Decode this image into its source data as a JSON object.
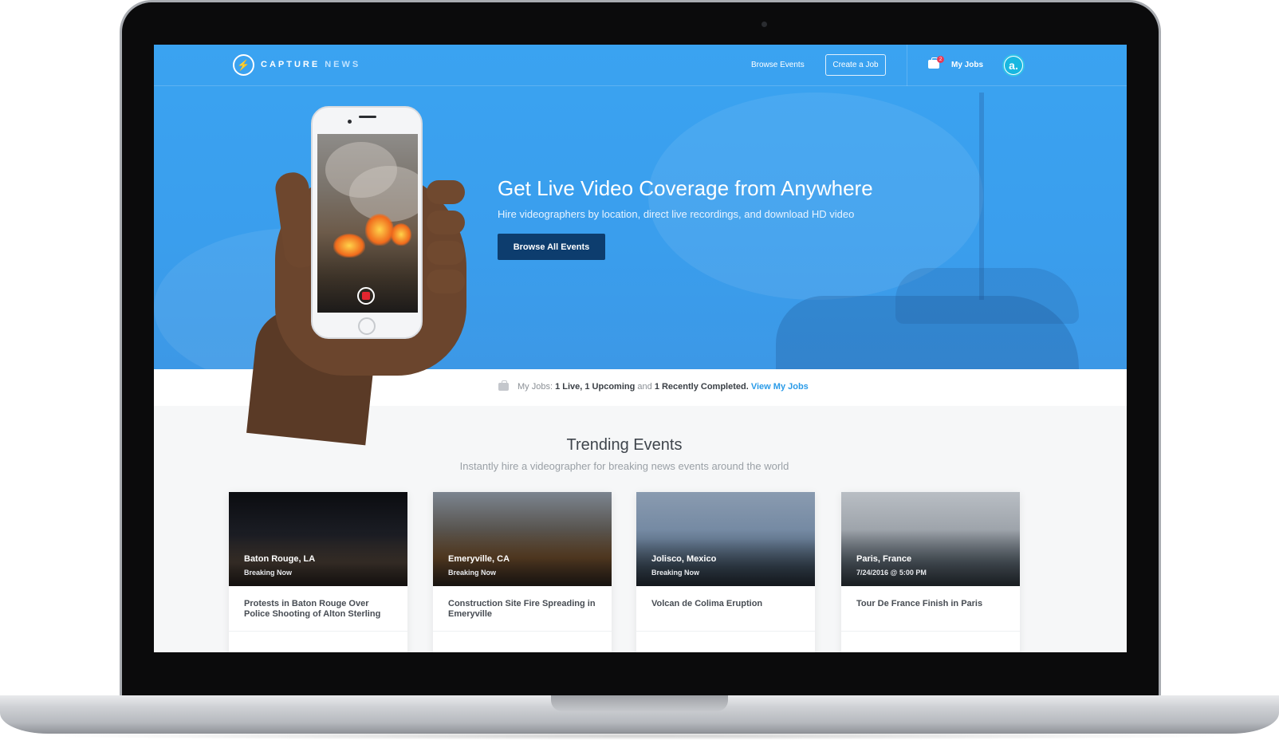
{
  "nav": {
    "logo_left": "CAPTURE",
    "logo_right": "NEWS",
    "browse_events": "Browse Events",
    "create_job": "Create a Job",
    "my_jobs": "My Jobs",
    "jobs_badge": "2",
    "avatar_letter": "a."
  },
  "hero": {
    "title": "Get Live Video Coverage from Anywhere",
    "subtitle": "Hire videographers by location, direct live recordings, and download HD video",
    "button": "Browse All Events"
  },
  "jobs_bar": {
    "label": "My Jobs:",
    "summary_a": "1 Live, 1 Upcoming",
    "and": "and",
    "summary_b": "1 Recently Completed.",
    "link": "View My Jobs"
  },
  "trending": {
    "title": "Trending Events",
    "subtitle": "Instantly hire a videographer for breaking news events around the world",
    "cards": [
      {
        "location": "Baton Rouge, LA",
        "status": "Breaking Now",
        "title": "Protests in Baton Rouge Over Police Shooting of Alton Sterling"
      },
      {
        "location": "Emeryville, CA",
        "status": "Breaking Now",
        "title": "Construction Site Fire Spreading in Emeryville"
      },
      {
        "location": "Jolisco, Mexico",
        "status": "Breaking Now",
        "title": "Volcan de Colima Eruption"
      },
      {
        "location": "Paris, France",
        "status": "7/24/2016 @ 5:00 PM",
        "title": "Tour De France Finish in Paris"
      }
    ]
  },
  "colors": {
    "hero_blue": "#3aa3f1",
    "button_navy": "#0d3d6e",
    "link_blue": "#2a9be8",
    "badge_red": "#e83a55",
    "avatar_teal": "#19b7e0"
  },
  "icons": [
    "bolt-icon",
    "briefcase-icon",
    "record-icon"
  ]
}
